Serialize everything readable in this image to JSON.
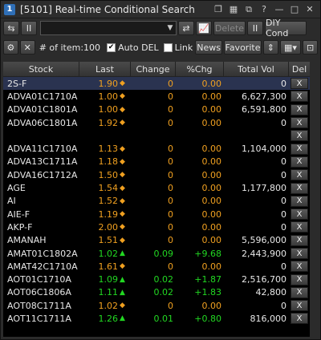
{
  "window": {
    "icon_label": "1",
    "title": "[5101] Real-time Conditional Search"
  },
  "title_buttons": [
    {
      "name": "title-btn-1",
      "glyph": "❐"
    },
    {
      "name": "title-btn-2",
      "glyph": "▦"
    },
    {
      "name": "title-btn-3",
      "glyph": "⧉"
    },
    {
      "name": "help-button",
      "glyph": "?"
    },
    {
      "name": "minimize-button",
      "glyph": "—"
    },
    {
      "name": "maximize-button",
      "glyph": "□"
    },
    {
      "name": "close-button",
      "glyph": "✕"
    }
  ],
  "toolbar1": {
    "pause_label": "II",
    "delete_label": "Delete",
    "pause2_label": "II",
    "diy_label": "DIY Cond"
  },
  "toolbar2": {
    "items_label": "# of item:100",
    "auto_del_label": "Auto DEL",
    "auto_del_checked": "✔",
    "link_label": "Link",
    "news_label": "News",
    "favorite_label": "Favorite"
  },
  "columns": {
    "stock": "Stock",
    "last": "Last",
    "change": "Change",
    "pct": "%Chg",
    "vol": "Total Vol",
    "del": "Del"
  },
  "rows": [
    {
      "stock": "2S-F",
      "last": "1.90",
      "ind": "◆",
      "change": "0",
      "pct": "0.00",
      "vol": "0",
      "color": "orange",
      "selected": true
    },
    {
      "stock": "ADVA01C1710A",
      "last": "1.00",
      "ind": "◆",
      "change": "0",
      "pct": "0.00",
      "vol": "6,627,300",
      "color": "orange"
    },
    {
      "stock": "ADVA01C1801A",
      "last": "1.00",
      "ind": "◆",
      "change": "0",
      "pct": "0.00",
      "vol": "6,591,800",
      "color": "orange"
    },
    {
      "stock": "ADVA06C1801A",
      "last": "1.92",
      "ind": "◆",
      "change": "0",
      "pct": "0.00",
      "vol": "0",
      "color": "orange"
    },
    {
      "stock": "",
      "last": "",
      "ind": "",
      "change": "",
      "pct": "",
      "vol": "",
      "color": "orange"
    },
    {
      "stock": "ADVA11C1710A",
      "last": "1.13",
      "ind": "◆",
      "change": "0",
      "pct": "0.00",
      "vol": "1,104,000",
      "color": "orange"
    },
    {
      "stock": "ADVA13C1711A",
      "last": "1.18",
      "ind": "◆",
      "change": "0",
      "pct": "0.00",
      "vol": "0",
      "color": "orange"
    },
    {
      "stock": "ADVA16C1712A",
      "last": "1.50",
      "ind": "◆",
      "change": "0",
      "pct": "0.00",
      "vol": "0",
      "color": "orange"
    },
    {
      "stock": "AGE",
      "last": "1.54",
      "ind": "◆",
      "change": "0",
      "pct": "0.00",
      "vol": "1,177,800",
      "color": "orange"
    },
    {
      "stock": "AI",
      "last": "1.52",
      "ind": "◆",
      "change": "0",
      "pct": "0.00",
      "vol": "0",
      "color": "orange"
    },
    {
      "stock": "AIE-F",
      "last": "1.19",
      "ind": "◆",
      "change": "0",
      "pct": "0.00",
      "vol": "0",
      "color": "orange"
    },
    {
      "stock": "AKP-F",
      "last": "2.00",
      "ind": "◆",
      "change": "0",
      "pct": "0.00",
      "vol": "0",
      "color": "orange"
    },
    {
      "stock": "AMANAH",
      "last": "1.51",
      "ind": "◆",
      "change": "0",
      "pct": "0.00",
      "vol": "5,596,000",
      "color": "orange"
    },
    {
      "stock": "AMAT01C1802A",
      "last": "1.02",
      "ind": "▲",
      "change": "0.09",
      "pct": "+9.68",
      "vol": "2,443,900",
      "color": "green"
    },
    {
      "stock": "AMAT42C1710A",
      "last": "1.61",
      "ind": "◆",
      "change": "0",
      "pct": "0.00",
      "vol": "0",
      "color": "orange"
    },
    {
      "stock": "AOT01C1710A",
      "last": "1.09",
      "ind": "▲",
      "change": "0.02",
      "pct": "+1.87",
      "vol": "2,516,700",
      "color": "green"
    },
    {
      "stock": "AOT06C1806A",
      "last": "1.11",
      "ind": "▲",
      "change": "0.02",
      "pct": "+1.83",
      "vol": "42,800",
      "color": "green"
    },
    {
      "stock": "AOT08C1711A",
      "last": "1.02",
      "ind": "◆",
      "change": "0",
      "pct": "0.00",
      "vol": "0",
      "color": "orange"
    },
    {
      "stock": "AOT11C1711A",
      "last": "1.26",
      "ind": "▲",
      "change": "0.01",
      "pct": "+0.80",
      "vol": "816,000",
      "color": "green"
    }
  ],
  "del_label": "X",
  "colors": {
    "orange": "#f0a020",
    "green": "#22d822",
    "selected_row": "#2a3350"
  }
}
